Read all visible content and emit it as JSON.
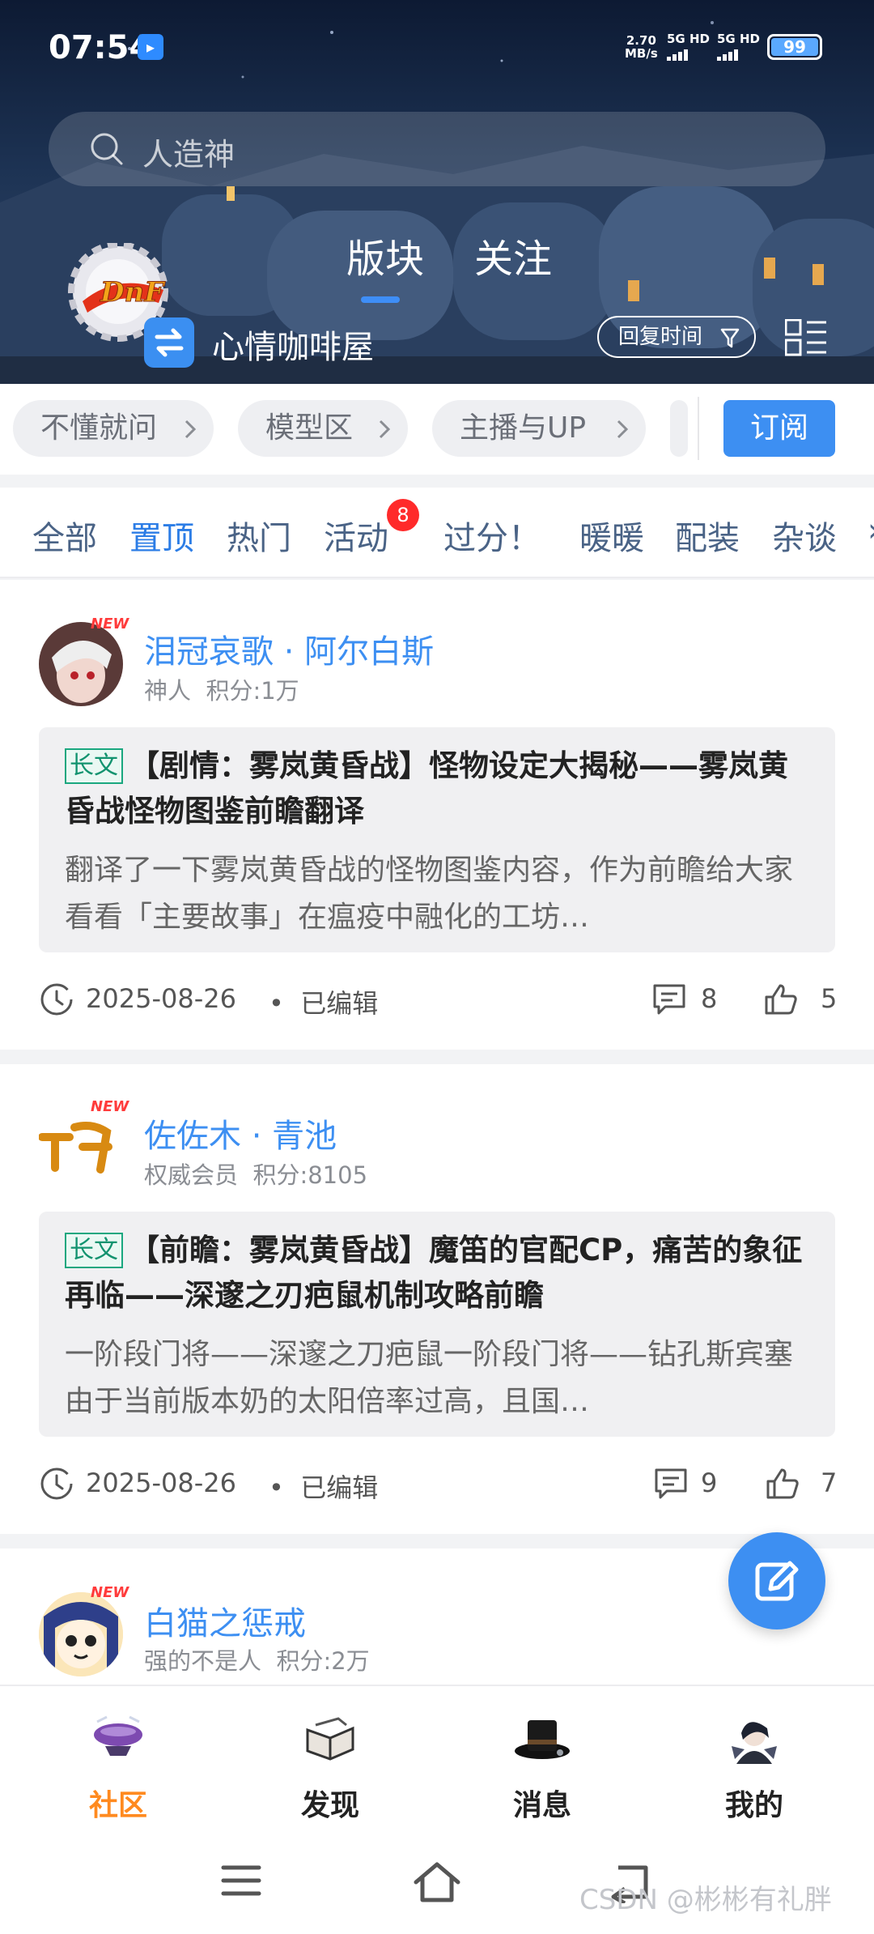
{
  "status_bar": {
    "time": "07:54",
    "net_speed": "2.70",
    "net_unit": "MB/s",
    "sim1": "5G HD",
    "sim2": "5G HD",
    "battery": "99"
  },
  "search": {
    "placeholder": "人造神"
  },
  "top_tabs": [
    {
      "label": "版块",
      "active": true
    },
    {
      "label": "关注",
      "active": false
    }
  ],
  "forum": {
    "name": "心情咖啡屋",
    "sort_label": "回复时间",
    "logo_text": "DnF"
  },
  "shortcuts": [
    "不懂就问",
    "模型区",
    "主播与UP"
  ],
  "subscribe_label": "订阅",
  "categories": [
    "全部",
    "置顶",
    "热门",
    "活动",
    "过分！",
    "暖暖",
    "配装",
    "杂谈"
  ],
  "activity_badge": "8",
  "new_label": "NEW",
  "posts": [
    {
      "author": "泪冠哀歌 · 阿尔白斯",
      "rank": "神人",
      "score": "积分:1万",
      "tag": "长文",
      "title": "【剧情：雾岚黄昏战】怪物设定大揭秘——雾岚黄昏战怪物图鉴前瞻翻译",
      "excerpt": "翻译了一下雾岚黄昏战的怪物图鉴内容，作为前瞻给大家看看「主要故事」在瘟疫中融化的工坊…",
      "date": "2025-08-26",
      "edited": "已编辑",
      "comments": "8",
      "likes": "5"
    },
    {
      "author": "佐佐木 · 青池",
      "rank": "权威会员",
      "score": "积分:8105",
      "tag": "长文",
      "title": "【前瞻：雾岚黄昏战】魔笛的官配CP，痛苦的象征再临——深邃之刃疤鼠机制攻略前瞻",
      "excerpt": "一阶段门将——深邃之刀疤鼠一阶段门将——钻孔斯宾塞由于当前版本奶的太阳倍率过高，且国…",
      "date": "2025-08-26",
      "edited": "已编辑",
      "comments": "9",
      "likes": "7"
    },
    {
      "author": "白猫之惩戒",
      "rank": "强的不是人",
      "score": "积分:2万"
    }
  ],
  "bottom_nav": [
    {
      "label": "社区",
      "icon": "community-airship-icon",
      "active": true
    },
    {
      "label": "发现",
      "icon": "discover-book-icon",
      "active": false
    },
    {
      "label": "消息",
      "icon": "message-hat-icon",
      "active": false
    },
    {
      "label": "我的",
      "icon": "profile-avatar-icon",
      "active": false
    }
  ],
  "watermark": "CSDN @彬彬有礼胖",
  "colors": {
    "accent": "#3d8ff2",
    "nav_active": "#ff8a1f",
    "badge": "#ff2a2a",
    "long_tag": "#12936f"
  }
}
